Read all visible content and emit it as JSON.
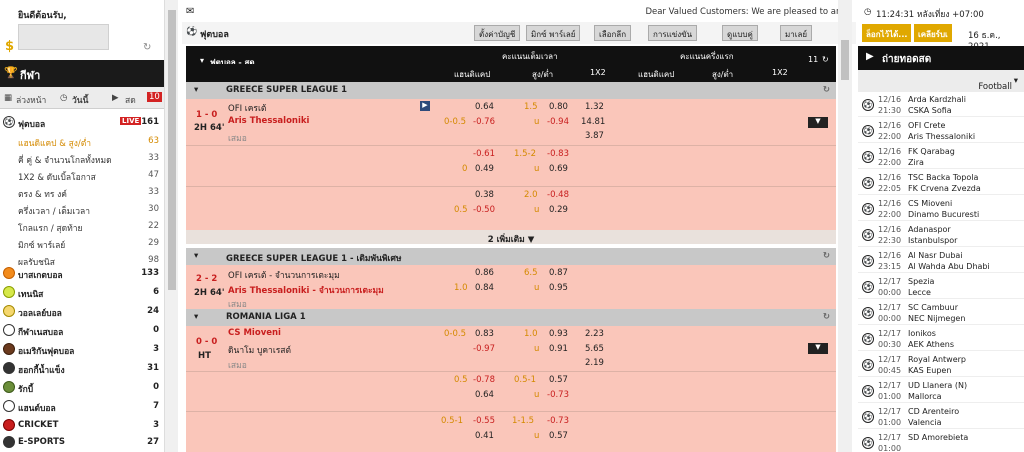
{
  "left": {
    "welcome": "ยินดีต้อนรับ,",
    "sport_title": "กีฬา",
    "period": {
      "early": "ล่วงหน้า",
      "today": "วันนี้",
      "live": "สด",
      "live_count": "10"
    },
    "football": {
      "label": "ฟุตบอล",
      "badge": "LIVE",
      "count": "161"
    },
    "sub_items": [
      {
        "label": "แฮนดิแคป & สูง/ต่ำ",
        "count": "63"
      },
      {
        "label": "คี่ คู่ & จำนวนโกลทั้งหมด",
        "count": "33"
      },
      {
        "label": "1X2 & ดับเบิ้ลโอกาส",
        "count": "47"
      },
      {
        "label": "ตรง & ทร งค์",
        "count": "33"
      },
      {
        "label": "ครึ่งเวลา / เต็มเวลา",
        "count": "30"
      },
      {
        "label": "โกลแรก / สุดท้าย",
        "count": "22"
      },
      {
        "label": "มิกซ์ พาร์เลย์",
        "count": "29"
      },
      {
        "label": "ผลรับชนิส",
        "count": "98"
      }
    ],
    "sports": [
      {
        "label": "บาสเกตบอล",
        "count": "133"
      },
      {
        "label": "เทนนิส",
        "count": "6"
      },
      {
        "label": "วอลเลย์บอล",
        "count": "24"
      },
      {
        "label": "กีฬาเนสบอล",
        "count": "0"
      },
      {
        "label": "อเมริกันฟุตบอล",
        "count": "3"
      },
      {
        "label": "ฮอกกี้น้ำแข็ง",
        "count": "31"
      },
      {
        "label": "รักบี้",
        "count": "0"
      },
      {
        "label": "แฮนด์บอล",
        "count": "7"
      },
      {
        "label": "CRICKET",
        "count": "3"
      },
      {
        "label": "E-SPORTS",
        "count": "27"
      }
    ]
  },
  "center": {
    "notice": "Dear Valued Customers: We are pleased to anno",
    "title": "ฟุตบอล",
    "buttons": [
      "ตั้งค่าบัญชี",
      "มิกซ์ พาร์เลย์",
      "เลือกลีก",
      "การแข่งขัน",
      "ดูแบบคู่",
      "มาเลย์"
    ],
    "header": {
      "full_time": "คะแนนเต็มเวลา",
      "first_half": "คะแนนครึ่งแรก",
      "col_match": "ฟุตบอล - สด",
      "handicap": "แฮนดิแคป",
      "over_under": "สูง/ต่ำ",
      "x12": "1X2",
      "handicap2": "แฮนดิแคป",
      "over_under2": "สูง/ต่ำ",
      "x12_2": "1X2",
      "count": "11"
    },
    "leagues": [
      {
        "name": "GREECE SUPER LEAGUE 1"
      },
      {
        "name": "GREECE SUPER LEAGUE 1 - เดิมพันพิเศษ"
      },
      {
        "name": "ROMANIA LIGA 1"
      }
    ],
    "m1": {
      "score": "1 - 0",
      "time": "2H 64'",
      "home": "OFI เครเต้",
      "away": "Aris Thessaloniki",
      "draw": "เสมอ",
      "r1": {
        "hdp": "",
        "h1": "0.64",
        "ou": "1.5",
        "o1": "0.80",
        "x1": "1.32"
      },
      "r2": {
        "hdp": "0-0.5",
        "h1": "-0.76",
        "ou": "u",
        "o1": "-0.94",
        "x1": "14.81"
      },
      "r3": {
        "x1": "3.87"
      },
      "r4": {
        "h1": "-0.61",
        "ou": "1.5-2",
        "o1": "-0.83"
      },
      "r5": {
        "hdp": "0",
        "h1": "0.49",
        "ou": "u",
        "o1": "0.69"
      },
      "r6": {
        "h1": "0.38",
        "ou": "2.0",
        "o1": "-0.48"
      },
      "r7": {
        "hdp": "0.5",
        "h1": "-0.50",
        "ou": "u",
        "o1": "0.29"
      }
    },
    "more_label": "2 เพิ่มเติม ▼",
    "m2": {
      "score": "2 - 2",
      "time": "2H 64'",
      "home": "OFI เครเต้ - จำนวนการเตะมุม",
      "away": "Aris Thessaloniki - จำนวนการเตะมุม",
      "draw": "เสมอ",
      "r1": {
        "h1": "0.86",
        "ou": "6.5",
        "o1": "0.87"
      },
      "r2": {
        "hdp": "1.0",
        "h1": "0.84",
        "ou": "u",
        "o1": "0.95"
      }
    },
    "m3": {
      "score": "0 - 0",
      "time": "HT",
      "home": "CS Mioveni",
      "away": "ดินาโม บูคาเรสต์",
      "draw": "เสมอ",
      "r1": {
        "hdp": "0-0.5",
        "h1": "0.83",
        "ou": "1.0",
        "o1": "0.93",
        "x1": "2.23"
      },
      "r2": {
        "h1": "-0.97",
        "ou": "u",
        "o1": "0.91",
        "x1": "5.65"
      },
      "r3": {
        "x1": "2.19"
      },
      "r4": {
        "hdp": "0.5",
        "h1": "-0.78",
        "ou": "0.5-1",
        "o1": "0.57"
      },
      "r5": {
        "h1": "0.64",
        "ou": "u",
        "o1": "-0.73"
      },
      "r6": {
        "hdp": "0.5-1",
        "h1": "-0.55",
        "ou": "1-1.5",
        "o1": "-0.73"
      },
      "r7": {
        "h1": "0.41",
        "ou": "u",
        "o1": "0.57"
      }
    }
  },
  "right": {
    "time": "11:24:31 หลังเที่ยง +07:00",
    "date": "16 ธ.ค., 2021",
    "btn1": "ล็อกไว้ได้...",
    "btn2": "เคลียร์บเ",
    "live_title": "ถ่ายทอดสด",
    "live_select": "Football",
    "matches": [
      {
        "date": "12/16",
        "time": "21:30",
        "home": "Arda Kardzhali",
        "away": "CSKA Sofia"
      },
      {
        "date": "12/16",
        "time": "22:00",
        "home": "OFI Crete",
        "away": "Aris Thessaloniki"
      },
      {
        "date": "12/16",
        "time": "22:00",
        "home": "FK Qarabag",
        "away": "Zira"
      },
      {
        "date": "12/16",
        "time": "22:05",
        "home": "TSC Backa Topola",
        "away": "FK Crvena Zvezda"
      },
      {
        "date": "12/16",
        "time": "22:00",
        "home": "CS Mioveni",
        "away": "Dinamo Bucuresti"
      },
      {
        "date": "12/16",
        "time": "22:30",
        "home": "Adanaspor",
        "away": "Istanbulspor"
      },
      {
        "date": "12/16",
        "time": "23:15",
        "home": "Al Nasr Dubai",
        "away": "Al Wahda Abu Dhabi"
      },
      {
        "date": "12/17",
        "time": "00:00",
        "home": "Spezia",
        "away": "Lecce"
      },
      {
        "date": "12/17",
        "time": "00:00",
        "home": "SC Cambuur",
        "away": "NEC Nijmegen"
      },
      {
        "date": "12/17",
        "time": "00:30",
        "home": "Ionikos",
        "away": "AEK Athens"
      },
      {
        "date": "12/17",
        "time": "00:45",
        "home": "Royal Antwerp",
        "away": "KAS Eupen"
      },
      {
        "date": "12/17",
        "time": "01:00",
        "home": "UD Llanera (N)",
        "away": "Mallorca"
      },
      {
        "date": "12/17",
        "time": "01:00",
        "home": "CD Arenteiro",
        "away": "Valencia"
      },
      {
        "date": "12/17",
        "time": "01:00",
        "home": "SD Amorebieta",
        "away": ""
      }
    ]
  }
}
